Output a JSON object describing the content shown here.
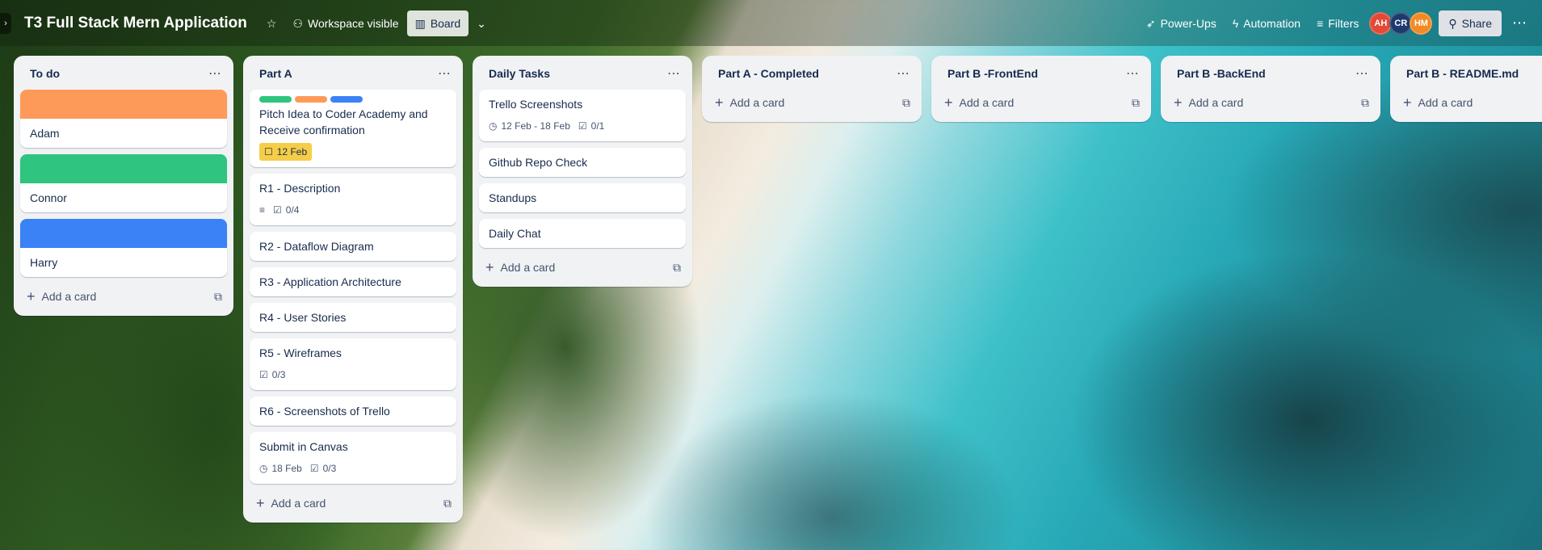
{
  "header": {
    "title": "T3 Full Stack Mern Application",
    "visibility_label": "Workspace visible",
    "view_label": "Board",
    "powerups_label": "Power-Ups",
    "automation_label": "Automation",
    "filters_label": "Filters",
    "share_label": "Share",
    "members": [
      {
        "initials": "AH",
        "color": "#e34935"
      },
      {
        "initials": "CR",
        "color": "#1d3a6e"
      },
      {
        "initials": "HM",
        "color": "#f08a24"
      }
    ]
  },
  "lists": [
    {
      "title": "To do",
      "add_label": "Add a card",
      "cards": [
        {
          "title": "Adam",
          "cover": "#fd9a5a"
        },
        {
          "title": "Connor",
          "cover": "#2fc47f"
        },
        {
          "title": "Harry",
          "cover": "#3b82f6"
        }
      ]
    },
    {
      "title": "Part A",
      "add_label": "Add a card",
      "cards": [
        {
          "title": "Pitch Idea to Coder Academy and Receive confirmation",
          "labels": [
            "#2fc47f",
            "#fd9a5a",
            "#3b82f6"
          ],
          "due": "12 Feb"
        },
        {
          "title": "R1 - Description",
          "checklist": "0/4",
          "has_description": true
        },
        {
          "title": "R2 - Dataflow Diagram"
        },
        {
          "title": "R3 - Application Architecture"
        },
        {
          "title": "R4 - User Stories"
        },
        {
          "title": "R5 - Wireframes",
          "checklist": "0/3"
        },
        {
          "title": "R6 - Screenshots of Trello"
        },
        {
          "title": "Submit in Canvas",
          "date": "18 Feb",
          "checklist": "0/3"
        }
      ]
    },
    {
      "title": "Daily Tasks",
      "add_label": "Add a card",
      "cards": [
        {
          "title": "Trello Screenshots",
          "date": "12 Feb - 18 Feb",
          "checklist": "0/1"
        },
        {
          "title": "Github Repo Check"
        },
        {
          "title": "Standups"
        },
        {
          "title": "Daily Chat"
        }
      ]
    },
    {
      "title": "Part A - Completed",
      "add_label": "Add a card",
      "cards": []
    },
    {
      "title": "Part B -FrontEnd",
      "add_label": "Add a card",
      "cards": []
    },
    {
      "title": "Part B -BackEnd",
      "add_label": "Add a card",
      "cards": []
    },
    {
      "title": "Part B - README.md",
      "add_label": "Add a card",
      "cards": []
    }
  ],
  "icons": {
    "star": "star-icon",
    "visibility": "users-icon",
    "board": "board-icon",
    "chevron": "chevron-down-icon",
    "powerups": "rocket-icon",
    "automation": "bolt-icon",
    "filters": "filter-icon",
    "share": "person-add-icon",
    "more": "more-icon",
    "clock": "clock-icon",
    "checklist": "checkbox-icon",
    "description": "description-icon",
    "template": "template-icon"
  }
}
